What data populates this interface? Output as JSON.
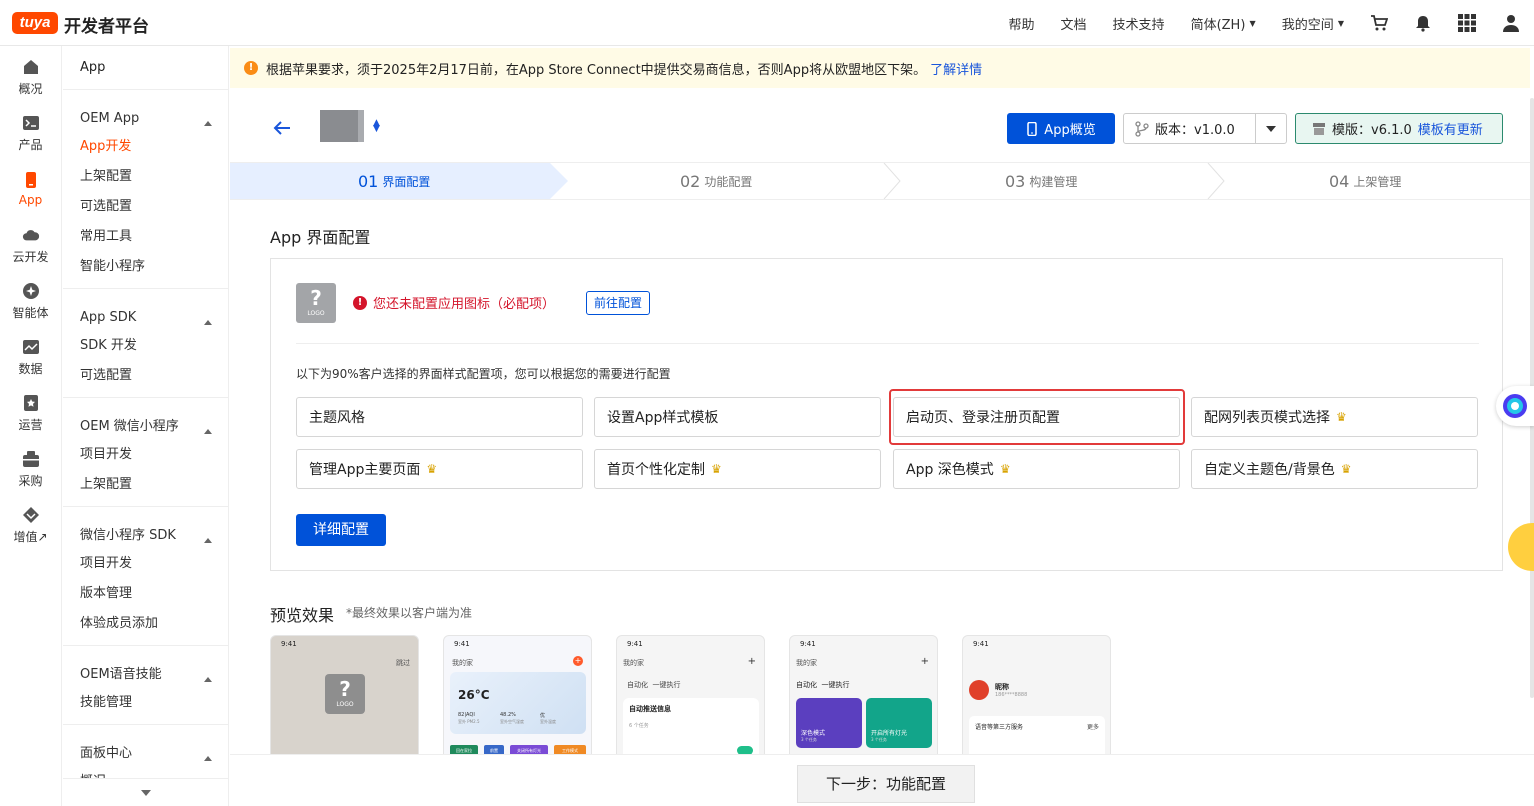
{
  "topbar": {
    "logo": "tuya",
    "brand": "开发者平台",
    "links": [
      "帮助",
      "文档",
      "技术支持",
      "简体(ZH)",
      "我的空间"
    ],
    "icons": [
      "cart-icon",
      "bell-icon",
      "apps-grid-icon",
      "user-icon"
    ]
  },
  "rail": {
    "items": [
      {
        "label": "概况",
        "icon": "home-icon"
      },
      {
        "label": "产品",
        "icon": "terminal-icon"
      },
      {
        "label": "App",
        "icon": "phone-icon"
      },
      {
        "label": "云开发",
        "icon": "cloud-icon"
      },
      {
        "label": "智能体",
        "icon": "sparkle-icon"
      },
      {
        "label": "数据",
        "icon": "chart-icon"
      },
      {
        "label": "运营",
        "icon": "bookmark-icon"
      },
      {
        "label": "采购",
        "icon": "cart-box-icon"
      },
      {
        "label": "增值↗",
        "icon": "diamond-icon"
      }
    ],
    "active": "App"
  },
  "sidebar": {
    "top": "App",
    "groups": [
      {
        "title": "OEM App",
        "items": [
          "App开发",
          "上架配置",
          "可选配置",
          "常用工具",
          "智能小程序"
        ]
      },
      {
        "title": "App SDK",
        "items": [
          "SDK 开发",
          "可选配置"
        ]
      },
      {
        "title": "OEM 微信小程序",
        "items": [
          "项目开发",
          "上架配置"
        ]
      },
      {
        "title": "微信小程序 SDK",
        "items": [
          "项目开发",
          "版本管理",
          "体验成员添加"
        ]
      },
      {
        "title": "OEM语音技能",
        "items": [
          "技能管理"
        ]
      },
      {
        "title": "面板中心",
        "items": [
          "概况"
        ]
      }
    ]
  },
  "banner": {
    "text": "根据苹果要求，须于2025年2月17日前，在App Store Connect中提供交易商信息，否则App将从欧盟地区下架。",
    "link": "了解详情"
  },
  "header": {
    "overview_button": "App概览",
    "version_label": "版本：v1.0.0",
    "template_label": "模版：v6.1.0",
    "template_update": "模板有更新"
  },
  "steps": [
    {
      "num": "01",
      "label": "界面配置"
    },
    {
      "num": "02",
      "label": "功能配置"
    },
    {
      "num": "03",
      "label": "构建管理"
    },
    {
      "num": "04",
      "label": "上架管理"
    }
  ],
  "section": {
    "title": "App 界面配置",
    "icon_q": "?",
    "icon_logo": "LOGO",
    "warning": "您还未配置应用图标（必配项）",
    "go_config": "前往配置",
    "hint": "以下为90%客户选择的界面样式配置项，您可以根据您的需要进行配置",
    "options": [
      {
        "label": "主题风格",
        "crown": false
      },
      {
        "label": "设置App样式模板",
        "crown": false
      },
      {
        "label": "启动页、登录注册页配置",
        "crown": false
      },
      {
        "label": "配网列表页模式选择",
        "crown": true
      },
      {
        "label": "管理App主要页面",
        "crown": true
      },
      {
        "label": "首页个性化定制",
        "crown": true
      },
      {
        "label": "App 深色模式",
        "crown": true
      },
      {
        "label": "自定义主题色/背景色",
        "crown": true
      }
    ],
    "detail_button": "详细配置"
  },
  "preview": {
    "title": "预览效果",
    "note": "*最终效果以客户端为准",
    "phones": [
      {
        "time": "9:41",
        "skip": "跳过",
        "q": "?",
        "logo": "LOGO"
      },
      {
        "time": "9:41",
        "home": "我的家",
        "temp": "26°C",
        "aqi": "82|AQI",
        "hum": "48.2%",
        "good": "优",
        "aqi_sub": "室外 PM2.5",
        "hum_sub": "室外空气湿度",
        "good_sub": "室外温度",
        "tags": [
          "回在家拉",
          "前置",
          "关闭所有灯光",
          "工作模式"
        ]
      },
      {
        "time": "9:41",
        "home": "我的家",
        "tabs": "自动化  一键执行",
        "title": "自动推送信息",
        "sub": "6 个任务"
      },
      {
        "time": "9:41",
        "home": "我的家",
        "tabs": "自动化  一键执行",
        "card1": "深色模式",
        "card1_sub": "3 个任务",
        "card2": "开启所有灯光",
        "card2_sub": "3 个任务"
      },
      {
        "time": "9:41",
        "nick": "昵称",
        "phone": "186****8888",
        "row": "语音等第三方服务",
        "more": "更多"
      }
    ]
  },
  "bottom": {
    "next_button": "下一步：功能配置"
  },
  "colors": {
    "brand": "#ff4800",
    "primary": "#0052d9",
    "danger": "#d4152b",
    "banner_bg": "#fffbe6"
  }
}
